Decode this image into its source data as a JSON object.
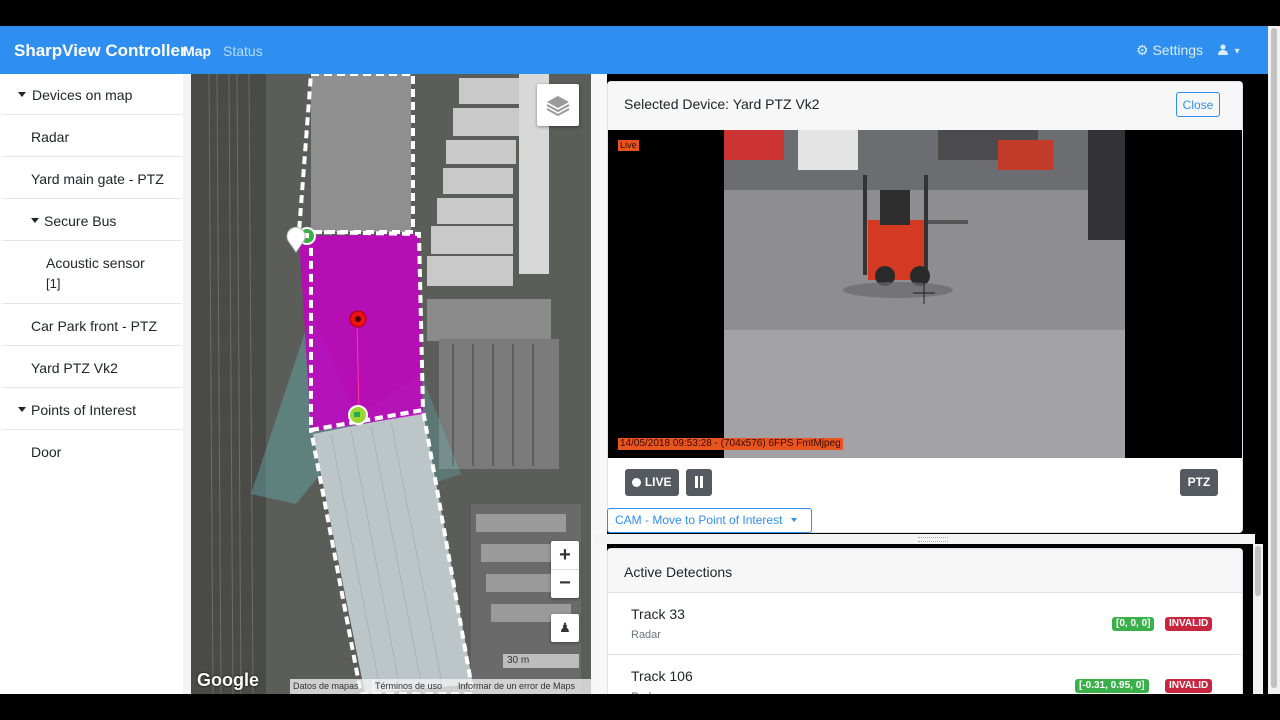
{
  "navbar": {
    "brand": "SharpView Controller",
    "nav_map": "Map",
    "nav_status": "Status",
    "settings_label": "Settings",
    "user_caret": "▾"
  },
  "sidebar": {
    "items": [
      {
        "label": "Devices on map",
        "expanded": true
      },
      {
        "label": "Radar"
      },
      {
        "label": "Yard main gate - PTZ"
      },
      {
        "label": "Secure Bus",
        "expanded": true
      },
      {
        "label": "Acoustic sensor",
        "suffix": "[1]"
      },
      {
        "label": "Car Park front - PTZ"
      },
      {
        "label": "Yard PTZ Vk2"
      },
      {
        "label": "Points of Interest",
        "expanded": true
      },
      {
        "label": "Door"
      }
    ]
  },
  "map": {
    "zoom_in": "+",
    "zoom_out": "−",
    "scale": "30 m",
    "logo": "Google",
    "footer_links": [
      "Datos de mapas",
      "Términos de uso",
      "Informar de un error de Maps"
    ],
    "zone_color": "#c400c4"
  },
  "device_panel": {
    "title": "Selected Device: Yard PTZ Vk2",
    "close_label": "Close",
    "video": {
      "live_tag": "Live",
      "stamp": "14/05/2018 09:53:28 - (704x576) 6FPS FmtMjpeg"
    },
    "live_label": "LIVE",
    "ptz_label": "PTZ",
    "cam_dropdown": "CAM - Move to Point of Interest"
  },
  "detections": {
    "title": "Active Detections",
    "tracks": [
      {
        "name": "Track 33",
        "source": "Radar",
        "coords": "[0, 0, 0]",
        "status": "INVALID"
      },
      {
        "name": "Track 106",
        "source": "Radar",
        "coords": "[-0.31, 0.95, 0]",
        "status": "INVALID"
      }
    ]
  },
  "colors": {
    "navbar": "#2e8ff0",
    "accent": "#2e8ff0",
    "badge_valid": "#3bb04a",
    "badge_invalid": "#c8253f",
    "video_overlay": "#e8541e"
  }
}
